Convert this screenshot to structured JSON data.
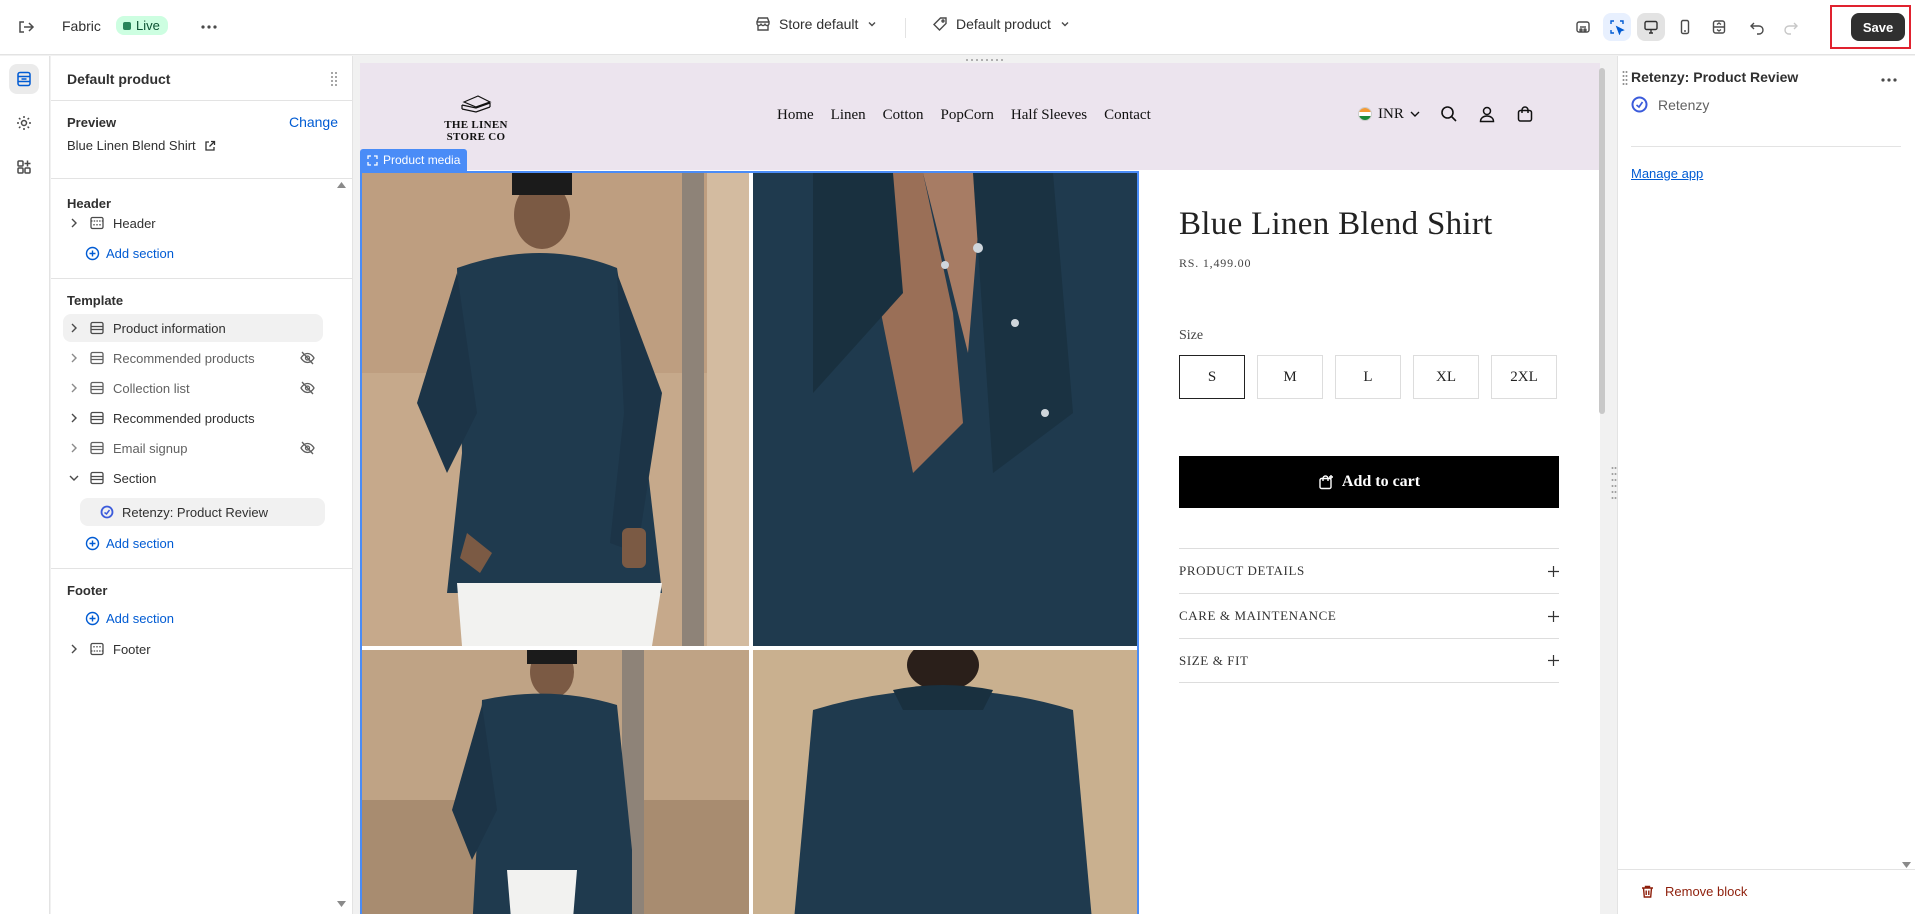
{
  "topbar": {
    "theme_name": "Fabric",
    "status": "Live",
    "store_selector": "Store default",
    "template_selector": "Default product",
    "save_label": "Save"
  },
  "left_panel": {
    "title": "Default product",
    "preview_label": "Preview",
    "change_label": "Change",
    "preview_value": "Blue Linen Blend Shirt",
    "header_group": "Header",
    "header_item": "Header",
    "add_section": "Add section",
    "template_group": "Template",
    "template_items": [
      {
        "label": "Product information",
        "hidden": false
      },
      {
        "label": "Recommended products",
        "hidden": true
      },
      {
        "label": "Collection list",
        "hidden": true
      },
      {
        "label": "Recommended products",
        "hidden": false
      },
      {
        "label": "Email signup",
        "hidden": true
      },
      {
        "label": "Section",
        "hidden": false
      }
    ],
    "section_child": "Retenzy: Product Review",
    "footer_group": "Footer",
    "footer_item": "Footer"
  },
  "store": {
    "logo_line1": "THE LINEN",
    "logo_line2": "STORE CO",
    "nav": [
      "Home",
      "Linen",
      "Cotton",
      "PopCorn",
      "Half Sleeves",
      "Contact"
    ],
    "currency": "INR",
    "media_tag": "Product media",
    "product_title": "Blue Linen Blend Shirt",
    "price": "RS. 1,499.00",
    "size_label": "Size",
    "sizes": [
      "S",
      "M",
      "L",
      "XL",
      "2XL"
    ],
    "selected_size": "S",
    "add_to_cart": "Add to cart",
    "accordions": [
      "PRODUCT DETAILS",
      "CARE & MAINTENANCE",
      "SIZE & FIT"
    ]
  },
  "right_panel": {
    "title": "Retenzy: Product Review",
    "app_name": "Retenzy",
    "manage_app": "Manage app",
    "remove_block": "Remove block"
  },
  "colors": {
    "accent_blue": "#005bd3",
    "selection_blue": "#4a8cf7",
    "store_header_bg": "#ece4ee",
    "shirt_navy": "#1f3a4e",
    "danger": "#8e1f0b"
  }
}
